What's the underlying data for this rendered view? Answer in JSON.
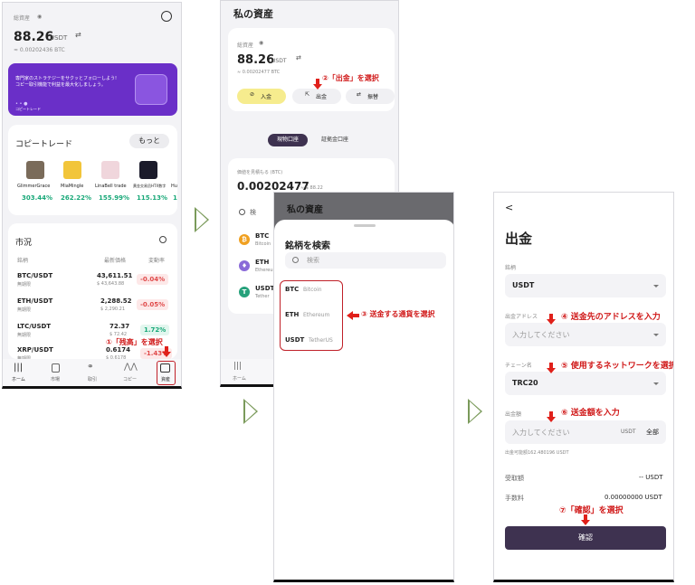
{
  "colors": {
    "accent": "#3e3250",
    "annotation": "#d01818",
    "positive": "#18a878",
    "negative": "#e04a4a",
    "banner": "#6a2fc8",
    "deposit": "#f6ec8e"
  },
  "screen1": {
    "total_label": "総資産",
    "balance": "88.26",
    "balance_unit": "USDT",
    "btc_equiv": "≈ 0.00202436 BTC",
    "banner_text": "専門家のストラテジーをサクッとフォローしよう! コピー取引機能で利益を最大化しましょう。",
    "banner_tag": "コピートレード",
    "copytrade_title": "コピートレード",
    "more_button": "もっと",
    "traders": [
      {
        "name": "GlimmerGrace",
        "pct": "303.44%"
      },
      {
        "name": "MiaMingle",
        "pct": "262.22%"
      },
      {
        "name": "LinaBell trade",
        "pct": "155.99%"
      },
      {
        "name": "黄金交易员HTX数字",
        "pct": "115.13%"
      },
      {
        "name": "Hu",
        "pct": "1"
      }
    ],
    "market_title": "市況",
    "col_symbol": "銘柄",
    "col_price": "最新価格",
    "col_change": "変動率",
    "rows": [
      {
        "sym": "BTC/USDT",
        "sub": "無期限",
        "price": "43,611.51",
        "fiat": "$ 43,643.88",
        "chg": "-0.04%",
        "dir": "neg"
      },
      {
        "sym": "ETH/USDT",
        "sub": "無期限",
        "price": "2,288.52",
        "fiat": "$ 2,290.21",
        "chg": "-0.05%",
        "dir": "neg"
      },
      {
        "sym": "LTC/USDT",
        "sub": "無期限",
        "price": "72.37",
        "fiat": "$ 72.42",
        "chg": "1.72%",
        "dir": "pos"
      },
      {
        "sym": "XRP/USDT",
        "sub": "無期限",
        "price": "0.6174",
        "fiat": "$ 0.6178",
        "chg": "-1.43%",
        "dir": "neg"
      }
    ],
    "nav": [
      "ホーム",
      "市場",
      "取引",
      "コピー",
      "資産"
    ],
    "annotation": "①「残高」を選択"
  },
  "screen2": {
    "title": "私の資産",
    "total_label": "総資産",
    "balance": "88.26",
    "balance_unit": "USDT",
    "btc_equiv": "≈ 0.00202477 BTC",
    "deposit": "入金",
    "withdraw": "出金",
    "transfer": "振替",
    "annotation": "②「出金」を選択",
    "tab_spot": "現物口座",
    "tab_margin": "証拠金口座",
    "estimate_label": "価値を見積もる (BTC)",
    "estimate_value": "0.00202477",
    "estimate_fiat": "≈ $ 88.22",
    "search_hint": "検",
    "coins": [
      {
        "sym": "BTC",
        "sub": "Bitcoin"
      },
      {
        "sym": "ETH",
        "sub": "Ethereum"
      },
      {
        "sym": "USDT",
        "sub": "Tether"
      }
    ],
    "nav_home": "ホーム"
  },
  "screen3": {
    "bg_title": "私の資産",
    "title": "銘柄を検索",
    "search_placeholder": "検索",
    "options": [
      {
        "sym": "BTC",
        "name": "Bitcoin"
      },
      {
        "sym": "ETH",
        "name": "Ethereum"
      },
      {
        "sym": "USDT",
        "name": "TetherUS"
      }
    ],
    "annotation": "③ 送金する通貨を選択"
  },
  "screen4": {
    "back": "<",
    "title": "出金",
    "coin_label": "銘柄",
    "coin_value": "USDT",
    "address_label": "出金アドレス",
    "address_placeholder": "入力してください",
    "chain_label": "チェーン名",
    "chain_value": "TRC20",
    "amount_label": "出金額",
    "amount_placeholder": "入力してください",
    "amount_unit": "USDT",
    "amount_all": "全部",
    "available": "出金可能額162.480196 USDT",
    "received_label": "受取額",
    "received_value": "-- USDT",
    "fee_label": "手数料",
    "fee_value": "0.00000000 USDT",
    "confirm": "確認",
    "ann4": "④ 送金先のアドレスを入力",
    "ann5": "⑤ 使用するネットワークを選択",
    "ann6": "⑥ 送金額を入力",
    "ann7": "⑦「確認」を選択"
  }
}
